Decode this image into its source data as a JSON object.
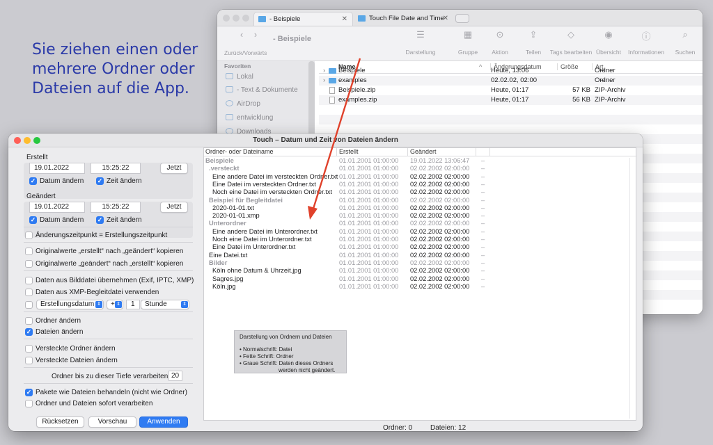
{
  "promo": {
    "lines": [
      "Sie ziehen einen oder",
      "mehrere Ordner oder",
      "Dateien auf die App."
    ]
  },
  "finder": {
    "tabs": [
      "- Beispiele",
      "Touch File Date and Time"
    ],
    "toolbar": {
      "back_forward": "Zurück/Vorwärts",
      "folder_title": "- Beispiele",
      "items": [
        "Darstellung",
        "Gruppe",
        "Aktion",
        "Teilen",
        "Tags bearbeiten",
        "Übersicht",
        "Informationen",
        "Suchen"
      ]
    },
    "sidebar": {
      "heading": "Favoriten",
      "items": [
        "Lokal",
        "- Text & Dokumente",
        "AirDrop",
        "entwicklung",
        "Downloads"
      ]
    },
    "columns": {
      "name": "Name",
      "date": "Änderungsdatum",
      "size": "Größe",
      "kind": "Art"
    },
    "rows": [
      {
        "name": "Beispiele",
        "date": "Heute, 13:06",
        "size": "--",
        "kind": "Ordner"
      },
      {
        "name": "examples",
        "date": "02.02.02, 02:00",
        "size": "--",
        "kind": "Ordner"
      },
      {
        "name": "Beispiele.zip",
        "date": "Heute, 01:17",
        "size": "57 KB",
        "kind": "ZIP-Archiv"
      },
      {
        "name": "examples.zip",
        "date": "Heute, 01:17",
        "size": "56 KB",
        "kind": "ZIP-Archiv"
      }
    ]
  },
  "touch": {
    "title": "Touch – Datum und Zeit von Dateien ändern",
    "created": {
      "label": "Erstellt",
      "date": "19.01.2022",
      "time": "15:25:22",
      "now": "Jetzt",
      "change_date": "Datum ändern",
      "change_time": "Zeit ändern"
    },
    "modified": {
      "label": "Geändert",
      "date": "19.01.2022",
      "time": "15:25:22",
      "now": "Jetzt",
      "change_date": "Datum ändern",
      "change_time": "Zeit ändern"
    },
    "options": {
      "mod_equals_created": "Änderungszeitpunkt = Erstellungszeitpunkt",
      "copy_created_to_mod": "Originalwerte „erstellt“ nach „geändert“ kopieren",
      "copy_mod_to_created": "Originalwerte „geändert“ nach „erstellt“ kopieren",
      "exif": "Daten aus Bilddatei übernehmen (Exif, IPTC, XMP)",
      "xmp": "Daten aus XMP-Begleitdatei verwenden",
      "offset_field": "Erstellungsdatum",
      "offset_sign": "+",
      "offset_value": "1",
      "offset_unit": "Stunde",
      "change_folders": "Ordner ändern",
      "change_files": "Dateien ändern",
      "hidden_folders": "Versteckte Ordner ändern",
      "hidden_files": "Versteckte Dateien ändern",
      "depth_label": "Ordner bis zu dieser Tiefe verarbeiten:",
      "depth_value": "20",
      "packages": "Pakete wie Dateien behandeln (nicht wie Ordner)",
      "immediate": "Ordner und Dateien sofort verarbeiten"
    },
    "buttons": {
      "reset": "Rücksetzen",
      "preview": "Vorschau",
      "apply": "Anwenden"
    },
    "table": {
      "headers": {
        "name": "Ordner- oder Dateiname",
        "created": "Erstellt",
        "modified": "Geändert"
      },
      "rows": [
        {
          "name": "Beispiele",
          "created": "01.01.2001  01:00:00",
          "modified": "19.01.2022  13:06:47",
          "mark": "–",
          "style": "gb",
          "indent": 0
        },
        {
          "name": ".versteckt",
          "created": "01.01.2001  01:00:00",
          "modified": "02.02.2002  02:00:00",
          "mark": "–",
          "style": "gb",
          "indent": 1
        },
        {
          "name": "Eine andere Datei im versteckten Ordner.txt",
          "created": "01.01.2001  01:00:00",
          "modified": "02.02.2002  02:00:00",
          "mark": "–",
          "style": "n",
          "indent": 2
        },
        {
          "name": "Eine Datei im versteckten Ordner.txt",
          "created": "01.01.2001  01:00:00",
          "modified": "02.02.2002  02:00:00",
          "mark": "–",
          "style": "n",
          "indent": 2
        },
        {
          "name": "Noch eine Datei im versteckten Ordner.txt",
          "created": "01.01.2001  01:00:00",
          "modified": "02.02.2002  02:00:00",
          "mark": "–",
          "style": "n",
          "indent": 2
        },
        {
          "name": "Beispiel für Begleitdatei",
          "created": "01.01.2001  01:00:00",
          "modified": "02.02.2002  02:00:00",
          "mark": "–",
          "style": "gb",
          "indent": 1
        },
        {
          "name": "2020-01-01.txt",
          "created": "01.01.2001  01:00:00",
          "modified": "02.02.2002  02:00:00",
          "mark": "–",
          "style": "n",
          "indent": 2
        },
        {
          "name": "2020-01-01.xmp",
          "created": "01.01.2001  01:00:00",
          "modified": "02.02.2002  02:00:00",
          "mark": "–",
          "style": "n",
          "indent": 2
        },
        {
          "name": "Unterordner",
          "created": "01.01.2001  01:00:00",
          "modified": "02.02.2002  02:00:00",
          "mark": "–",
          "style": "gb",
          "indent": 1
        },
        {
          "name": "Eine andere Datei im Unterordner.txt",
          "created": "01.01.2001  01:00:00",
          "modified": "02.02.2002  02:00:00",
          "mark": "–",
          "style": "n",
          "indent": 2
        },
        {
          "name": "Noch eine Datei im Unterordner.txt",
          "created": "01.01.2001  01:00:00",
          "modified": "02.02.2002  02:00:00",
          "mark": "–",
          "style": "n",
          "indent": 2
        },
        {
          "name": "Eine Datei im Unterordner.txt",
          "created": "01.01.2001  01:00:00",
          "modified": "02.02.2002  02:00:00",
          "mark": "–",
          "style": "n",
          "indent": 2
        },
        {
          "name": "Eine Datei.txt",
          "created": "01.01.2001  01:00:00",
          "modified": "02.02.2002  02:00:00",
          "mark": "–",
          "style": "n",
          "indent": 1
        },
        {
          "name": "Bilder",
          "created": "01.01.2001  01:00:00",
          "modified": "02.02.2002  02:00:00",
          "mark": "–",
          "style": "gb",
          "indent": 1
        },
        {
          "name": "Köln ohne Datum & Uhrzeit.jpg",
          "created": "01.01.2001  01:00:00",
          "modified": "02.02.2002  02:00:00",
          "mark": "–",
          "style": "n",
          "indent": 2
        },
        {
          "name": "Sagres.jpg",
          "created": "01.01.2001  01:00:00",
          "modified": "02.02.2002  02:00:00",
          "mark": "–",
          "style": "n",
          "indent": 2
        },
        {
          "name": "Köln.jpg",
          "created": "01.01.2001  01:00:00",
          "modified": "02.02.2002  02:00:00",
          "mark": "–",
          "style": "n",
          "indent": 2
        }
      ]
    },
    "tooltip": {
      "title": "Darstellung von Ordnern und Dateien",
      "line1": "• Normalschrift: Datei",
      "line2": "• Fette Schrift:   Ordner",
      "line3": "• Graue Schrift: Daten dieses Ordners",
      "line4": "werden nicht geändert."
    },
    "status": {
      "folders": "Ordner: 0",
      "files": "Dateien: 12"
    }
  },
  "colors": {
    "accent": "#2f7bf2",
    "promo_text": "#2b3aa8",
    "arrow": "#e0412b"
  }
}
